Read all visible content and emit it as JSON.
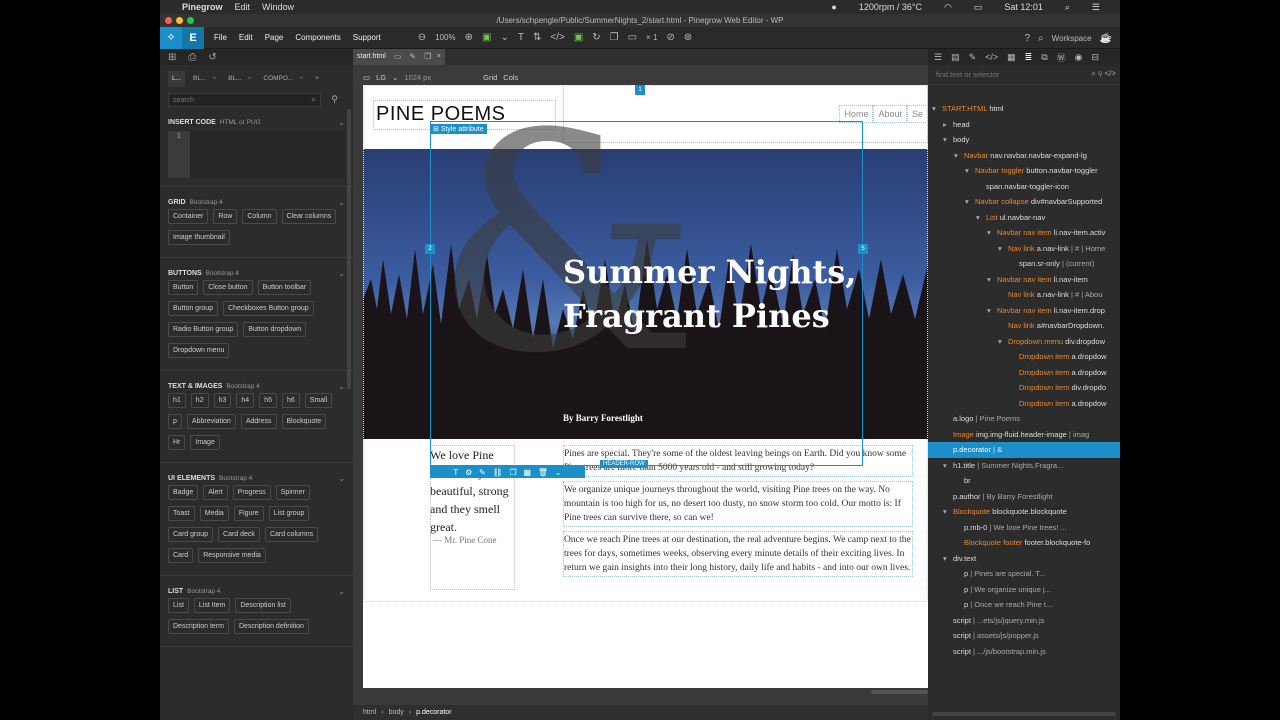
{
  "mac_menubar": {
    "app_name": "Pinegrow",
    "menus": [
      "Edit",
      "Window"
    ],
    "status": "1200rpm / 36°C",
    "clock": "Sat 12:01"
  },
  "window": {
    "title": "/Users/schpengle/Public/SummerNights_2/start.html - Pinegrow Web Editor - WP"
  },
  "toolbar": {
    "menus": [
      "File",
      "Edit",
      "Page",
      "Components",
      "Support"
    ],
    "zoom": "100%",
    "multiplier": "× 1",
    "workspace": "Workspace"
  },
  "left_panel": {
    "tabs": [
      "L...",
      "BL...",
      "BL...",
      "COMPO..."
    ],
    "search_placeholder": "search",
    "insert_code": {
      "title": "INSERT CODE",
      "sub": "HTML or PUG",
      "line": "1"
    },
    "sections": [
      {
        "title": "GRID",
        "sub": "Bootstrap 4",
        "items": [
          "Container",
          "Row",
          "Column",
          "Clear columns",
          "Image thumbnail"
        ]
      },
      {
        "title": "BUTTONS",
        "sub": "Bootstrap 4",
        "items": [
          "Button",
          "Close button",
          "Button toolbar",
          "Button group",
          "Checkboxes Button group",
          "Radio Button group",
          "Button dropdown",
          "Dropdown menu"
        ]
      },
      {
        "title": "TEXT & IMAGES",
        "sub": "Bootstrap 4",
        "items": [
          "h1",
          "h2",
          "h3",
          "h4",
          "h5",
          "h6",
          "Small",
          "p",
          "Abbreviation",
          "Address",
          "Blockquote",
          "Hr",
          "Image"
        ]
      },
      {
        "title": "UI ELEMENTS",
        "sub": "Bootstrap 4",
        "items": [
          "Badge",
          "Alert",
          "Progress",
          "Spinner",
          "Toast",
          "Media",
          "Figure",
          "List group",
          "Card group",
          "Card deck",
          "Card columns",
          "Card",
          "Responsive media"
        ]
      },
      {
        "title": "LIST",
        "sub": "Bootstrap 4",
        "items": [
          "List",
          "List Item",
          "Description list",
          "Description term",
          "Description definition"
        ]
      }
    ]
  },
  "editor": {
    "tab_name": "start.html",
    "breakpoint": "LG",
    "width": "1024 px",
    "grid_label": "Grid",
    "cols_label": "Cols",
    "style_attr_label": "Style attribute",
    "header_row_label": "HEADER-ROW",
    "badges": {
      "top": "1",
      "left": "2",
      "right": "5"
    },
    "page": {
      "logo": "PINE POEMS",
      "decorator": "&",
      "nav": [
        "Home",
        "About",
        "Se"
      ],
      "title_line1": "Summer Nights,",
      "title_line2": "Fragrant Pines",
      "author": "By Barry Forestlight",
      "quote": "We love Pine trees! They're beautiful, strong and they smell great.",
      "quote_footer": "— Mr. Pine Cone",
      "paragraphs": [
        "Pines are special. They're some of the oldest leaving beings on Earth. Did you know some Pine trees are more than 5000 years old - and still growing today?",
        "We organize unique journeys throughout the world, visiting Pine trees on the way. No mountain is too high for us, no desert too dusty, no snow storm too cold. Our motto is: If Pine trees can survive there, so can we!",
        "Once we reach Pine trees at our destination, the real adventure begins. We camp next to the trees for days, sometimes weeks, observing every minute details of their exciting lives. In return we gain insights into their long history, daily life and habits - and into our own lives."
      ]
    },
    "breadcrumb": [
      "html",
      "body",
      "p.decorator"
    ]
  },
  "right_panel": {
    "search_placeholder": "find text or selector",
    "tree": [
      {
        "indent": 0,
        "arrow": "▾",
        "comp": "START.HTML",
        "tag": " html",
        "txt": ""
      },
      {
        "indent": 1,
        "arrow": "▸",
        "comp": "",
        "tag": "head",
        "txt": ""
      },
      {
        "indent": 1,
        "arrow": "▾",
        "comp": "",
        "tag": "body",
        "txt": ""
      },
      {
        "indent": 2,
        "arrow": "▾",
        "comp": "Navbar",
        "tag": " nav.navbar.navbar-expand-lg",
        "txt": ""
      },
      {
        "indent": 3,
        "arrow": "▾",
        "comp": "Navbar toggler",
        "tag": " button.navbar-toggler",
        "txt": ""
      },
      {
        "indent": 4,
        "arrow": "",
        "comp": "",
        "tag": "span.navbar-toggler-icon",
        "txt": ""
      },
      {
        "indent": 3,
        "arrow": "▾",
        "comp": "Navbar collapse",
        "tag": " div#navbarSupported",
        "txt": ""
      },
      {
        "indent": 4,
        "arrow": "▾",
        "comp": "List",
        "tag": " ul.navbar-nav",
        "txt": ""
      },
      {
        "indent": 5,
        "arrow": "▾",
        "comp": "Navbar nav item",
        "tag": " li.nav-item.activ",
        "txt": ""
      },
      {
        "indent": 6,
        "arrow": "▾",
        "comp": "Nav link",
        "tag": " a.nav-link",
        "txt": " | # | Home"
      },
      {
        "indent": 7,
        "arrow": "",
        "comp": "",
        "tag": "span.sr-only",
        "txt": " | (current)"
      },
      {
        "indent": 5,
        "arrow": "▾",
        "comp": "Navbar nav item",
        "tag": " li.nav-item",
        "txt": ""
      },
      {
        "indent": 6,
        "arrow": "",
        "comp": "Nav link",
        "tag": " a.nav-link",
        "txt": " | # | Abou"
      },
      {
        "indent": 5,
        "arrow": "▾",
        "comp": "Navbar nav item",
        "tag": " li.nav-item.drop",
        "txt": ""
      },
      {
        "indent": 6,
        "arrow": "",
        "comp": "Nav link",
        "tag": " a#navbarDropdown.",
        "txt": ""
      },
      {
        "indent": 6,
        "arrow": "▾",
        "comp": "Dropdown menu",
        "tag": " div.dropdow",
        "txt": ""
      },
      {
        "indent": 7,
        "arrow": "",
        "comp": "Dropdown item",
        "tag": " a.dropdow",
        "txt": ""
      },
      {
        "indent": 7,
        "arrow": "",
        "comp": "Dropdown item",
        "tag": " a.dropdow",
        "txt": ""
      },
      {
        "indent": 7,
        "arrow": "",
        "comp": "Dropdown item",
        "tag": " div.dropdo",
        "txt": ""
      },
      {
        "indent": 7,
        "arrow": "",
        "comp": "Dropdown item",
        "tag": " a.dropdow",
        "txt": ""
      },
      {
        "indent": 1,
        "arrow": "",
        "comp": "",
        "tag": "a.logo",
        "txt": " | Pine Poems"
      },
      {
        "indent": 1,
        "arrow": "",
        "comp": "Image",
        "tag": " img.img-fluid.header-image",
        "txt": " | imag"
      },
      {
        "indent": 1,
        "arrow": "",
        "comp": "",
        "tag": "p.decorator",
        "txt": " | &",
        "selected": true
      },
      {
        "indent": 1,
        "arrow": "▾",
        "comp": "",
        "tag": "h1.title",
        "txt": " | Summer Nights,Fragra..."
      },
      {
        "indent": 2,
        "arrow": "",
        "comp": "",
        "tag": "br",
        "txt": ""
      },
      {
        "indent": 1,
        "arrow": "",
        "comp": "",
        "tag": "p.author",
        "txt": " | By Barry Forestlight"
      },
      {
        "indent": 1,
        "arrow": "▾",
        "comp": "Blockquote",
        "tag": " blockquote.blockquote",
        "txt": ""
      },
      {
        "indent": 2,
        "arrow": "",
        "comp": "",
        "tag": "p.mb-0",
        "txt": " | We love Pine trees! ..."
      },
      {
        "indent": 2,
        "arrow": "",
        "comp": "Blockquote footer",
        "tag": " footer.blockquote-fo",
        "txt": ""
      },
      {
        "indent": 1,
        "arrow": "▾",
        "comp": "",
        "tag": "div.text",
        "txt": ""
      },
      {
        "indent": 2,
        "arrow": "",
        "comp": "",
        "tag": "p",
        "txt": " | Pines are special. T..."
      },
      {
        "indent": 2,
        "arrow": "",
        "comp": "",
        "tag": "p",
        "txt": " | We organize unique j..."
      },
      {
        "indent": 2,
        "arrow": "",
        "comp": "",
        "tag": "p",
        "txt": " | Once we reach Pine t..."
      },
      {
        "indent": 1,
        "arrow": "",
        "comp": "",
        "tag": "script",
        "txt": " | ...ets/js/jquery.min.js"
      },
      {
        "indent": 1,
        "arrow": "",
        "comp": "",
        "tag": "script",
        "txt": " | assets/js/popper.js"
      },
      {
        "indent": 1,
        "arrow": "",
        "comp": "",
        "tag": "script",
        "txt": " | .../js/bootstrap.min.js"
      }
    ]
  },
  "colors": {
    "accent": "#1a8fc9",
    "component": "#e8882e"
  }
}
